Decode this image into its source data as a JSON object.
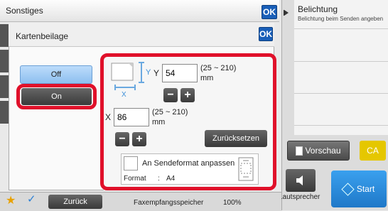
{
  "header": {
    "title": "Sonstiges",
    "ok_label": "OK"
  },
  "dialog": {
    "title": "Kartenbeilage",
    "ok_label": "OK"
  },
  "toggle": {
    "off_label": "Off",
    "on_label": "On"
  },
  "settings": {
    "y_label": "Y",
    "y_value": "54",
    "y_range": "(25 ~ 210)",
    "y_unit": "mm",
    "x_label": "X",
    "x_value": "86",
    "x_range": "(25 ~ 210)",
    "x_unit": "mm",
    "minus": "−",
    "plus": "+",
    "reset_label": "Zurücksetzen",
    "fit_label": "An Sendeformat anpassen",
    "format_label": "Format",
    "format_sep": ":",
    "format_value": "A4"
  },
  "right_panel": {
    "title": "Belichtung",
    "subtitle": "Belichtung beim Senden angeben",
    "preview_label": "Vorschau",
    "ca_label": "CA",
    "speaker_label": "Lautsprecher",
    "start_label": "Start"
  },
  "footer": {
    "back_label": "Zurück",
    "memory_label": "Faxempfangsspeicher",
    "memory_value": "100%"
  },
  "colors": {
    "accent_blue": "#1a5fb8",
    "highlight_red": "#e0102a",
    "ca_yellow": "#e5c700",
    "start_blue": "#2e8de0"
  }
}
